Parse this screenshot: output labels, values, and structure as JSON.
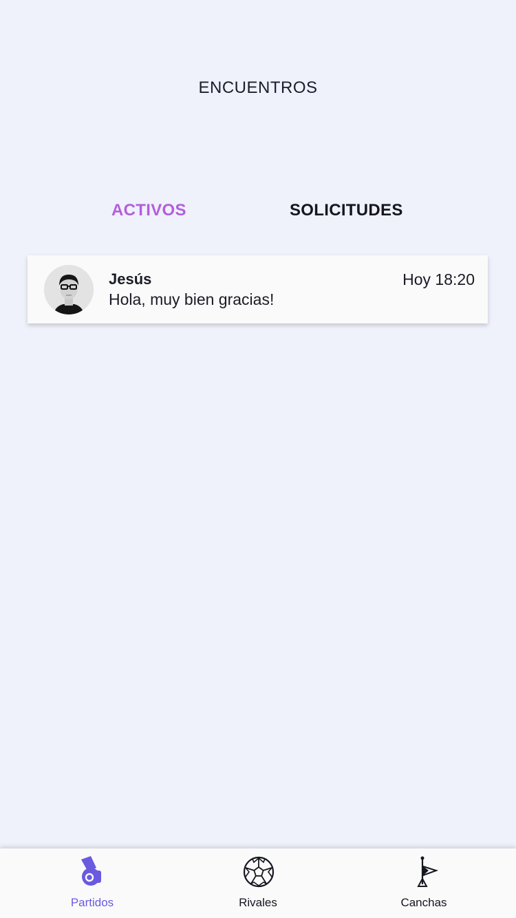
{
  "header": {
    "title": "ENCUENTROS"
  },
  "tabs": [
    {
      "label": "ACTIVOS",
      "selected": true
    },
    {
      "label": "SOLICITUDES",
      "selected": false
    }
  ],
  "chats": [
    {
      "name": "Jesús",
      "time": "Hoy 18:20",
      "message": "Hola, muy bien gracias!",
      "avatar": "user-photo"
    }
  ],
  "bottom_nav": {
    "items": [
      {
        "label": "Partidos",
        "icon": "whistle-icon",
        "active": true
      },
      {
        "label": "Rivales",
        "icon": "soccer-ball-icon",
        "active": false
      },
      {
        "label": "Canchas",
        "icon": "corner-flag-icon",
        "active": false
      }
    ]
  },
  "colors": {
    "background": "#eff1fb",
    "tab_active": "#b35fdc",
    "nav_active": "#6a5ae0",
    "text_dark": "#1b1c2a"
  }
}
